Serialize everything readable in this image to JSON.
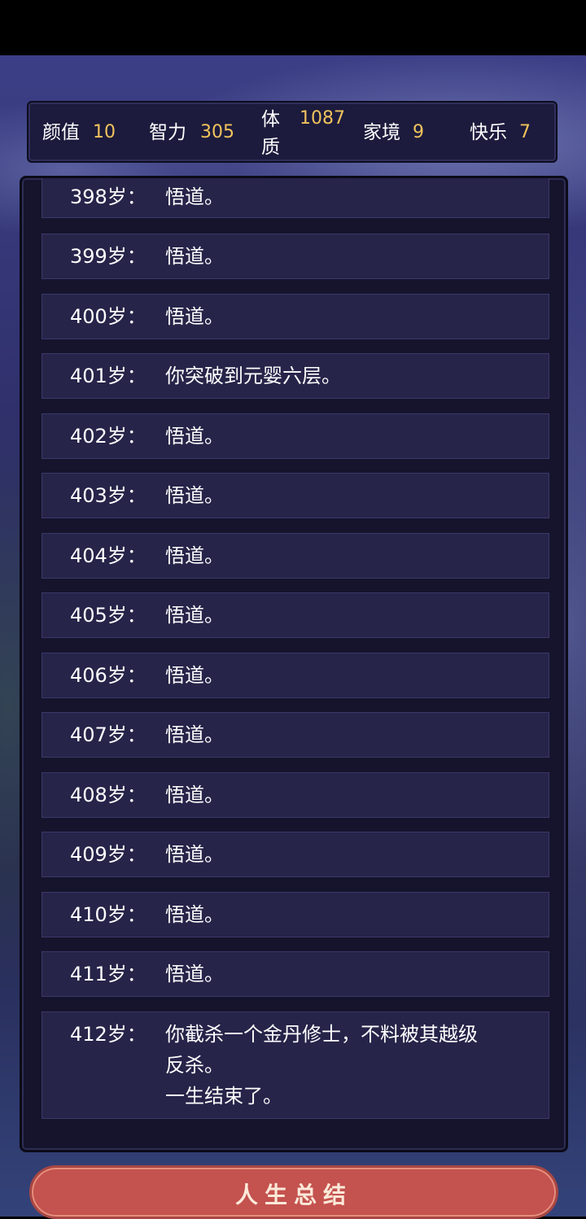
{
  "stats": [
    {
      "label": "颜值",
      "value": "10"
    },
    {
      "label": "智力",
      "value": "305"
    },
    {
      "label": "体质",
      "value": "1087"
    },
    {
      "label": "家境",
      "value": "9"
    },
    {
      "label": "快乐",
      "value": "7"
    }
  ],
  "log": [
    {
      "age": "398岁：",
      "event": "悟道。"
    },
    {
      "age": "399岁：",
      "event": "悟道。"
    },
    {
      "age": "400岁：",
      "event": "悟道。"
    },
    {
      "age": "401岁：",
      "event": "你突破到元婴六层。"
    },
    {
      "age": "402岁：",
      "event": "悟道。"
    },
    {
      "age": "403岁：",
      "event": "悟道。"
    },
    {
      "age": "404岁：",
      "event": "悟道。"
    },
    {
      "age": "405岁：",
      "event": "悟道。"
    },
    {
      "age": "406岁：",
      "event": "悟道。"
    },
    {
      "age": "407岁：",
      "event": "悟道。"
    },
    {
      "age": "408岁：",
      "event": "悟道。"
    },
    {
      "age": "409岁：",
      "event": "悟道。"
    },
    {
      "age": "410岁：",
      "event": "悟道。"
    },
    {
      "age": "411岁：",
      "event": "悟道。"
    },
    {
      "age": "412岁：",
      "event": "你截杀一个金丹修士，不料被其越级\n反杀。\n一生结束了。"
    }
  ],
  "summary_button": {
    "label": "人生总结"
  },
  "colors": {
    "stat_value": "#f1c35c",
    "row_bg": "#262449",
    "panel_bg": "#15142c",
    "button_bg": "#c4524f"
  }
}
